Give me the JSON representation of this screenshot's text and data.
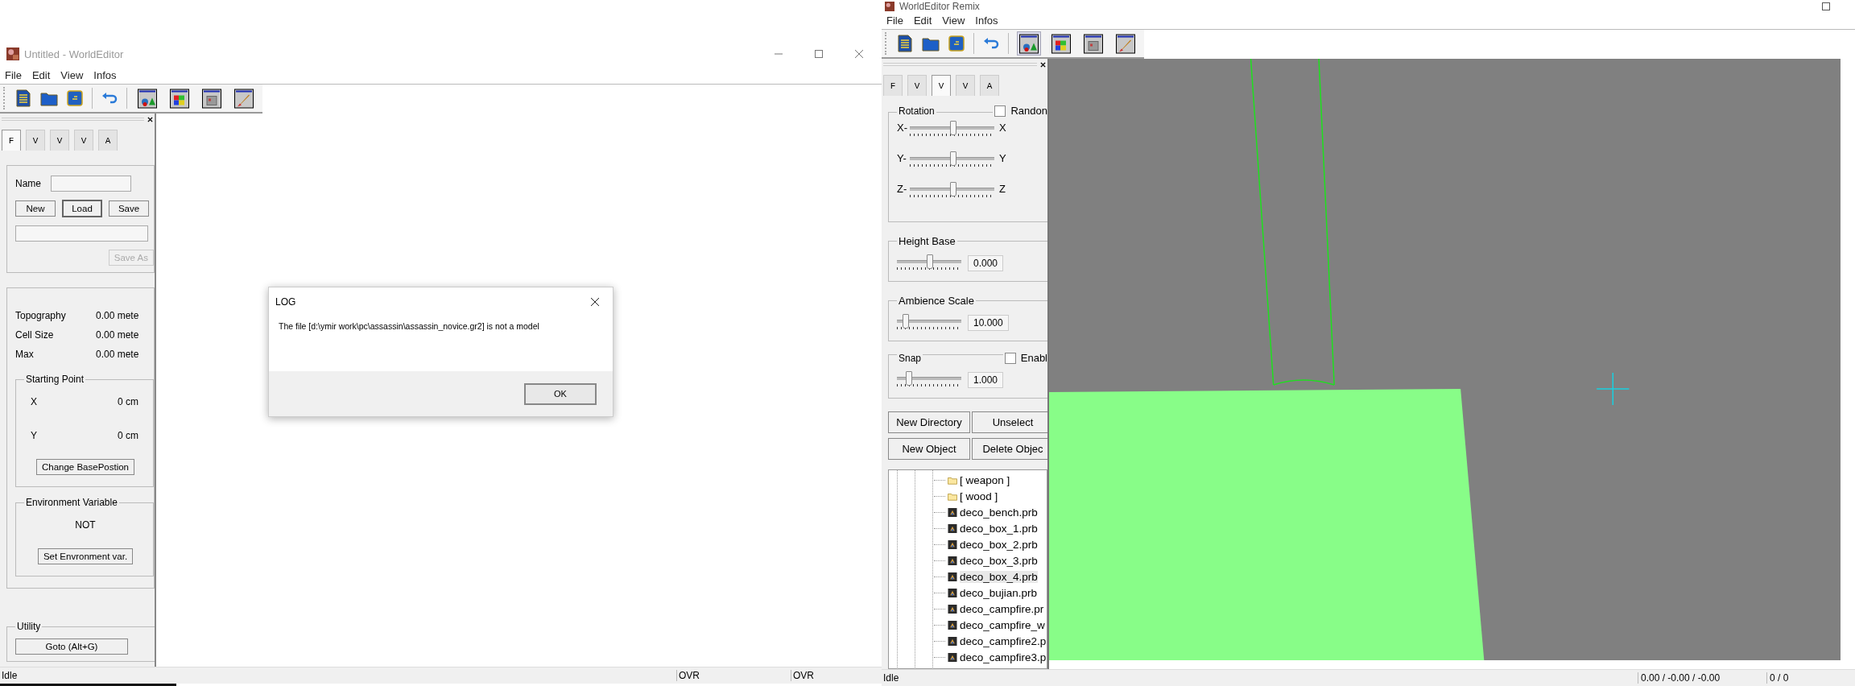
{
  "left_window": {
    "title": "Untitled - WorldEditor",
    "menu": [
      "File",
      "Edit",
      "View",
      "Infos"
    ],
    "toolbar_modes": [
      {
        "selected": false
      },
      {
        "selected": false
      },
      {
        "selected": false
      },
      {
        "selected": false
      }
    ],
    "tabs": [
      {
        "label": "F",
        "selected": true
      },
      {
        "label": "V",
        "selected": false
      },
      {
        "label": "V",
        "selected": false
      },
      {
        "label": "V",
        "selected": false
      },
      {
        "label": "A",
        "selected": false
      }
    ],
    "file_group": {
      "name_label": "Name",
      "buttons": [
        {
          "label": "New",
          "default": false
        },
        {
          "label": "Load",
          "default": true
        },
        {
          "label": "Save",
          "default": false
        }
      ],
      "save_as": {
        "label": "Save As",
        "disabled": true
      }
    },
    "info_rows": [
      {
        "label": "Topography",
        "value": "0.00 mete"
      },
      {
        "label": "Cell Size",
        "value": "0.00 mete"
      },
      {
        "label": "Max",
        "value": "0.00 mete"
      }
    ],
    "starting_point": {
      "title": "Starting Point",
      "rows": [
        {
          "label": "X",
          "value": "0 cm"
        },
        {
          "label": "Y",
          "value": "0 cm"
        }
      ],
      "button": "Change BasePostion"
    },
    "environment": {
      "title": "Environment Variable",
      "status": "NOT",
      "button": "Set Envronment var."
    },
    "utility": {
      "title": "Utility",
      "button": "Goto (Alt+G)"
    },
    "status_bar": [
      "Idle",
      "OVR",
      "OVR"
    ],
    "progress": {
      "level": 0.2
    }
  },
  "dialog": {
    "title": "LOG",
    "message": "The file [d:\\ymir work\\pc\\assassin\\assassin_novice.gr2] is not a model",
    "button": "OK"
  },
  "right_window": {
    "title": "WorldEditor Remix",
    "menu": [
      "File",
      "Edit",
      "View",
      "Infos"
    ],
    "toolbar_modes": [
      {
        "selected": true
      },
      {
        "selected": false
      },
      {
        "selected": false
      },
      {
        "selected": false
      }
    ],
    "tabs": [
      {
        "label": "F",
        "selected": false
      },
      {
        "label": "V",
        "selected": false
      },
      {
        "label": "V",
        "selected": true
      },
      {
        "label": "V",
        "selected": false
      },
      {
        "label": "A",
        "selected": false
      }
    ],
    "rotation": {
      "title": "Rotation",
      "random": {
        "label": "Randon",
        "checked": false
      },
      "axes": [
        {
          "minus": "X-",
          "plus": "X",
          "level": 0.5
        },
        {
          "minus": "Y-",
          "plus": "Y",
          "level": 0.5
        },
        {
          "minus": "Z-",
          "plus": "Z",
          "level": 0.5
        }
      ]
    },
    "height_base": {
      "title": "Height Base",
      "level": 0.5,
      "value": "0.000"
    },
    "ambience_scale": {
      "title": "Ambience Scale",
      "level": 0.12,
      "value": "10.000"
    },
    "snap": {
      "title": "Snap",
      "enable": {
        "label": "Enabl",
        "checked": false
      },
      "level": 0.18,
      "value": "1.000"
    },
    "buttons": [
      "New Directory",
      "Unselect",
      "New Object",
      "Delete Objec"
    ],
    "tree": [
      {
        "kind": "folder",
        "label": "[ weapon ]",
        "selected": false
      },
      {
        "kind": "folder",
        "label": "[ wood ]",
        "selected": false
      },
      {
        "kind": "file",
        "label": "deco_bench.prb",
        "selected": false
      },
      {
        "kind": "file",
        "label": "deco_box_1.prb",
        "selected": false
      },
      {
        "kind": "file",
        "label": "deco_box_2.prb",
        "selected": false
      },
      {
        "kind": "file",
        "label": "deco_box_3.prb",
        "selected": false
      },
      {
        "kind": "file",
        "label": "deco_box_4.prb",
        "selected": true
      },
      {
        "kind": "file",
        "label": "deco_bujian.prb",
        "selected": false
      },
      {
        "kind": "file",
        "label": "deco_campfire.pr",
        "selected": false
      },
      {
        "kind": "file",
        "label": "deco_campfire_w",
        "selected": false
      },
      {
        "kind": "file",
        "label": "deco_campfire2.p",
        "selected": false
      },
      {
        "kind": "file",
        "label": "deco_campfire3.p",
        "selected": false
      }
    ],
    "status_bar": [
      "Idle",
      "0.00 / -0.00 / -0.00",
      "0 / 0"
    ]
  }
}
